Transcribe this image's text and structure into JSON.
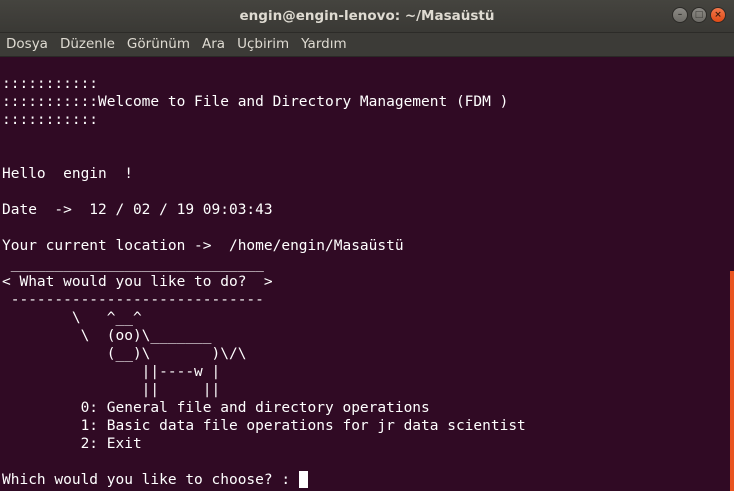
{
  "window": {
    "title": "engin@engin-lenovo: ~/Masaüstü",
    "controls": {
      "minimize": "–",
      "maximize": "□",
      "close": "×"
    }
  },
  "menu": [
    "Dosya",
    "Düzenle",
    "Görünüm",
    "Ara",
    "Uçbirim",
    "Yardım"
  ],
  "terminal": {
    "lines": [
      ":::::::::::",
      ":::::::::::Welcome to File and Directory Management (FDM )",
      ":::::::::::",
      "",
      "",
      "Hello  engin  !",
      "",
      "Date  ->  12 / 02 / 19 09:03:43",
      "",
      "Your current location ->  /home/engin/Masaüstü",
      " _____________________________",
      "< What would you like to do?  >",
      " -----------------------------",
      "        \\   ^__^",
      "         \\  (oo)\\_______",
      "            (__)\\       )\\/\\",
      "                ||----w |",
      "                ||     ||",
      "         0: General file and directory operations",
      "         1: Basic data file operations for jr data scientist",
      "         2: Exit",
      ""
    ],
    "prompt": "Which would you like to choose? : "
  },
  "colors": {
    "background": "#300a24",
    "foreground": "#ffffff",
    "scrollbar": "#e9541f",
    "titlebar": "#3c3b37"
  }
}
